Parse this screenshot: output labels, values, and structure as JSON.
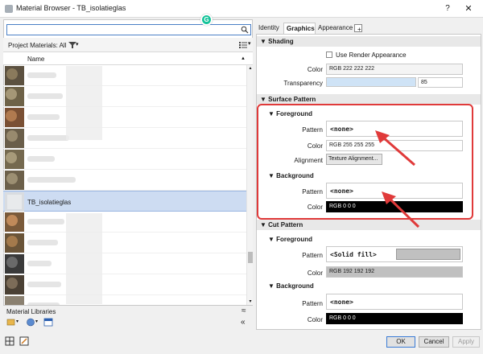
{
  "window": {
    "title": "Material Browser - TB_isolatieglas",
    "help": "?",
    "close": "✕"
  },
  "search": {
    "value": "",
    "placeholder": ""
  },
  "project_bar": {
    "label": "Project Materials: All"
  },
  "list": {
    "column_name": "Name",
    "rows": [
      {
        "label": ""
      },
      {
        "label": ""
      },
      {
        "label": ""
      },
      {
        "label": ""
      },
      {
        "label": ""
      },
      {
        "label": ""
      },
      {
        "label": "TB_isolatieglas",
        "selected": true
      },
      {
        "label": ""
      },
      {
        "label": ""
      },
      {
        "label": ""
      },
      {
        "label": ""
      },
      {
        "label": ""
      }
    ]
  },
  "libraries": {
    "label": "Material Libraries"
  },
  "tabs": {
    "identity": "Identity",
    "graphics": "Graphics",
    "appearance": "Appearance",
    "add": "+"
  },
  "shading": {
    "title": "Shading",
    "use_render_appearance": "Use Render Appearance",
    "color_label": "Color",
    "color_value": "RGB 222 222 222",
    "transparency_label": "Transparency",
    "transparency_value": "85"
  },
  "surface_pattern": {
    "title": "Surface Pattern",
    "foreground": {
      "title": "Foreground",
      "pattern_label": "Pattern",
      "pattern_value": "<none>",
      "color_label": "Color",
      "color_value": "RGB 255 255 255",
      "alignment_label": "Alignment",
      "alignment_button": "Texture Alignment..."
    },
    "background": {
      "title": "Background",
      "pattern_label": "Pattern",
      "pattern_value": "<none>",
      "color_label": "Color",
      "color_value": "RGB 0 0 0"
    }
  },
  "cut_pattern": {
    "title": "Cut Pattern",
    "foreground": {
      "title": "Foreground",
      "pattern_label": "Pattern",
      "pattern_value": "<Solid fill>",
      "color_label": "Color",
      "color_value": "RGB 192 192 192"
    },
    "background": {
      "title": "Background",
      "pattern_label": "Pattern",
      "pattern_value": "<none>",
      "color_label": "Color",
      "color_value": "RGB 0 0 0"
    }
  },
  "footer": {
    "ok": "OK",
    "cancel": "Cancel",
    "apply": "Apply"
  },
  "colors": {
    "highlight": "#e03a3a",
    "selection": "#cddcf2",
    "grammarly": "#15c39a"
  },
  "icons": [
    "search-icon",
    "filter-icon",
    "list-view-icon",
    "grammarly-icon",
    "collapse-up-icon",
    "library-icon",
    "globe-icon",
    "panel-icon",
    "collapse-left-icon"
  ]
}
